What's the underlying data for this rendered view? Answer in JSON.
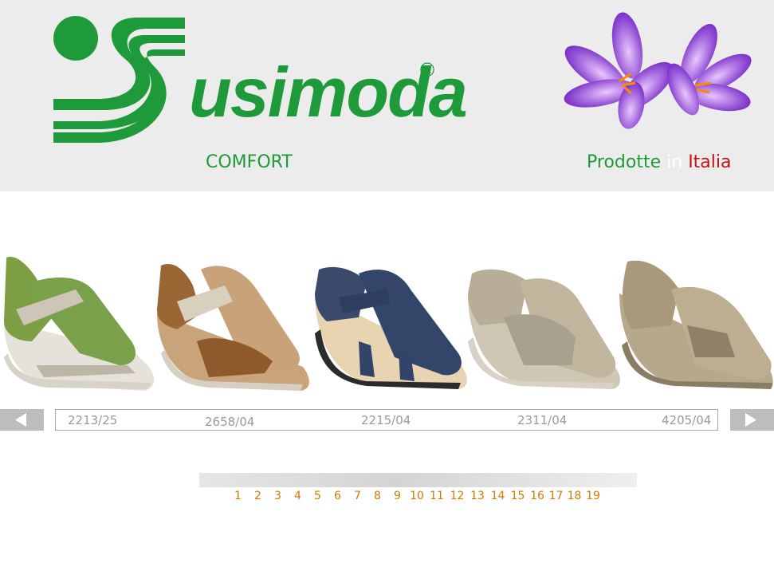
{
  "brand": {
    "name": "usimoda",
    "registered": "®",
    "tagline": "COMFORT"
  },
  "made_in": {
    "word1": "Prodotte",
    "word2": "in",
    "word3": "Italia"
  },
  "colors": {
    "brand_green": "#1f9a3b",
    "italy_red": "#c0121b",
    "page_link_orange": "#d07a00",
    "header_bg": "#ececec"
  },
  "carousel": {
    "prev_icon": "triangle-left-icon",
    "next_icon": "triangle-right-icon",
    "products": [
      {
        "code": "2213/25",
        "color": "green"
      },
      {
        "code": "2658/04",
        "color": "brown-beige"
      },
      {
        "code": "2215/04",
        "color": "navy"
      },
      {
        "code": "2311/04",
        "color": "taupe"
      },
      {
        "code": "4205/04",
        "color": "bronze"
      }
    ]
  },
  "pagination": {
    "pages": [
      "1",
      "2",
      "3",
      "4",
      "5",
      "6",
      "7",
      "8",
      "9",
      "10",
      "11",
      "12",
      "13",
      "14",
      "15",
      "16",
      "17",
      "18",
      "19"
    ]
  }
}
